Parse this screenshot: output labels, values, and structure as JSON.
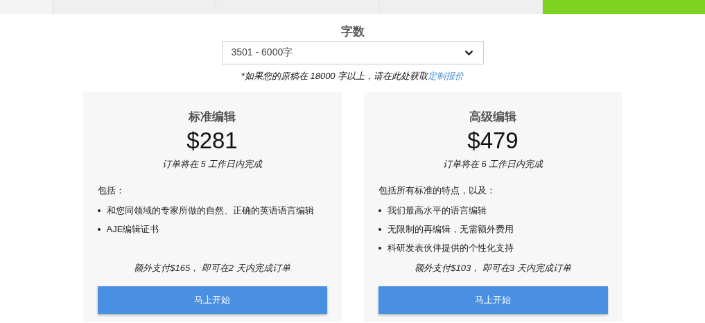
{
  "word_count": {
    "label": "字数",
    "value": "3501 - 6000字",
    "note": "*如果您的原稿在 18000 字以上，请在此处获取",
    "note_link": "定制报价"
  },
  "plans": [
    {
      "title": "标准编辑",
      "price": "$281",
      "turnaround": "订单将在 5 工作日内完成",
      "includes": "包括：",
      "features": [
        "和您同领域的专家所做的自然、正确的英语语言编辑",
        "AJE编辑证书"
      ],
      "rush": "额外支付$165， 即可在2 天内完成订单",
      "button": "马上开始"
    },
    {
      "title": "高级编辑",
      "price": "$479",
      "turnaround": "订单将在 6 工作日内完成",
      "includes": "包括所有标准的特点，以及：",
      "features": [
        "我们最高水平的语言编辑",
        "无限制的再编辑，无需额外费用",
        "科研发表伙伴提供的个性化支持"
      ],
      "rush": "额外支付$103， 即可在3 天内完成订单",
      "button": "马上开始"
    }
  ]
}
